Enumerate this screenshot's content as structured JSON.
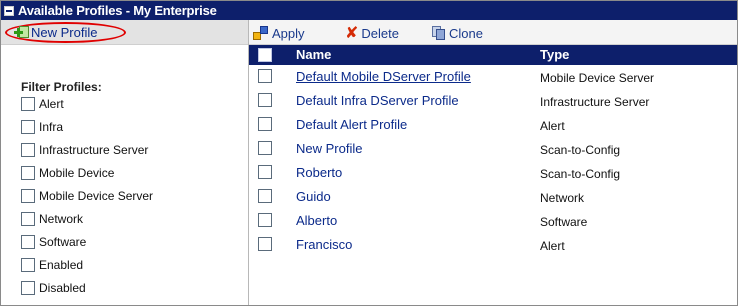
{
  "panel": {
    "title": "Available Profiles - My Enterprise"
  },
  "sidebar": {
    "new_profile_label": "New Profile",
    "filter_heading": "Filter Profiles:",
    "filters": [
      {
        "label": "Alert",
        "checked": false
      },
      {
        "label": "Infra",
        "checked": false
      },
      {
        "label": "Infrastructure Server",
        "checked": false
      },
      {
        "label": "Mobile Device",
        "checked": false
      },
      {
        "label": "Mobile Device Server",
        "checked": false
      },
      {
        "label": "Network",
        "checked": false
      },
      {
        "label": "Software",
        "checked": false
      },
      {
        "label": "Enabled",
        "checked": false
      },
      {
        "label": "Disabled",
        "checked": false
      }
    ]
  },
  "toolbar": {
    "apply_label": "Apply",
    "delete_label": "Delete",
    "clone_label": "Clone"
  },
  "table": {
    "columns": {
      "name": "Name",
      "type": "Type"
    },
    "rows": [
      {
        "name": "Default Mobile DServer Profile",
        "type": "Mobile Device Server",
        "underlined": true
      },
      {
        "name": "Default Infra DServer Profile",
        "type": "Infrastructure Server",
        "underlined": false
      },
      {
        "name": "Default Alert Profile",
        "type": "Alert",
        "underlined": false
      },
      {
        "name": "New Profile",
        "type": "Scan-to-Config",
        "underlined": false
      },
      {
        "name": "Roberto",
        "type": "Scan-to-Config",
        "underlined": false
      },
      {
        "name": "Guido",
        "type": "Network",
        "underlined": false
      },
      {
        "name": "Alberto",
        "type": "Software",
        "underlined": false
      },
      {
        "name": "Francisco",
        "type": "Alert",
        "underlined": false
      }
    ]
  },
  "colors": {
    "header_navy": "#0d1f6b",
    "link_blue": "#0b2a8a",
    "highlight_red": "#e00000"
  },
  "icons": {
    "collapse": "collapse-icon",
    "new_profile": "new-profile-icon",
    "apply": "apply-icon",
    "delete": "delete-icon",
    "clone": "clone-icon"
  }
}
